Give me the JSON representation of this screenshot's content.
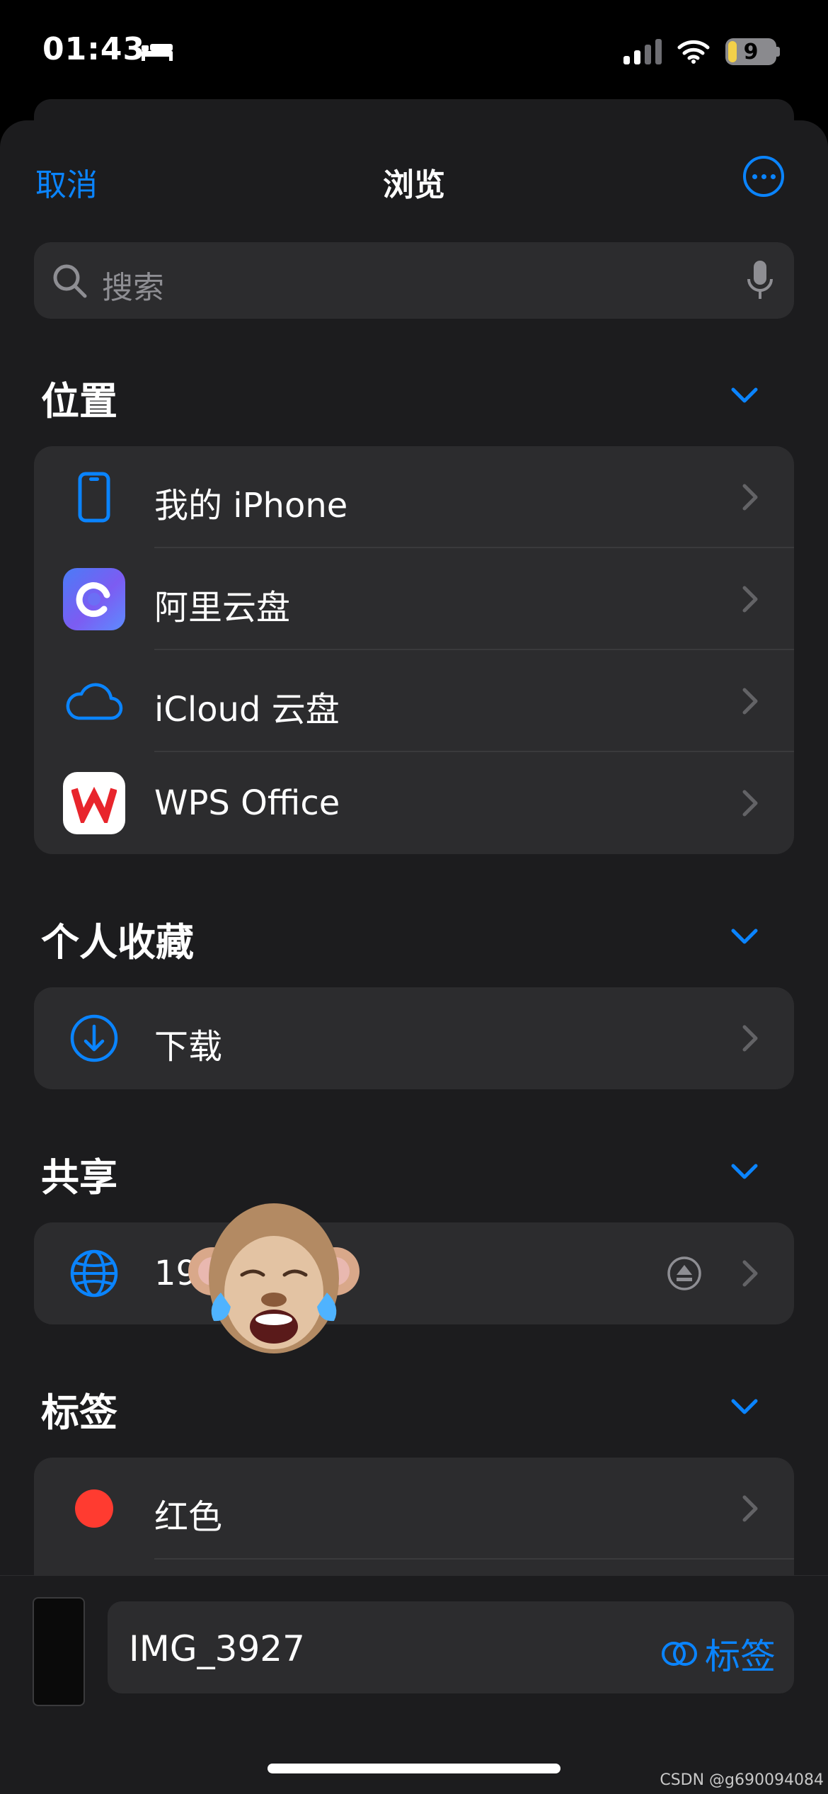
{
  "status": {
    "time": "01:43",
    "battery": "9"
  },
  "nav": {
    "cancel": "取消",
    "title": "浏览"
  },
  "search": {
    "placeholder": "搜索"
  },
  "sections": {
    "locations": {
      "title": "位置",
      "items": [
        "我的 iPhone",
        "阿里云盘",
        "iCloud 云盘",
        "WPS Office"
      ]
    },
    "favorites": {
      "title": "个人收藏",
      "items": [
        "下载"
      ]
    },
    "shared": {
      "title": "共享",
      "items": [
        "19"
      ]
    },
    "tags": {
      "title": "标签",
      "items": [
        "红色"
      ]
    }
  },
  "bottom": {
    "filename": "IMG_3927",
    "tag_label": "标签"
  },
  "watermark": "CSDN @g690094084",
  "colors": {
    "accent": "#0a84ff",
    "red_tag": "#ff3b30"
  }
}
